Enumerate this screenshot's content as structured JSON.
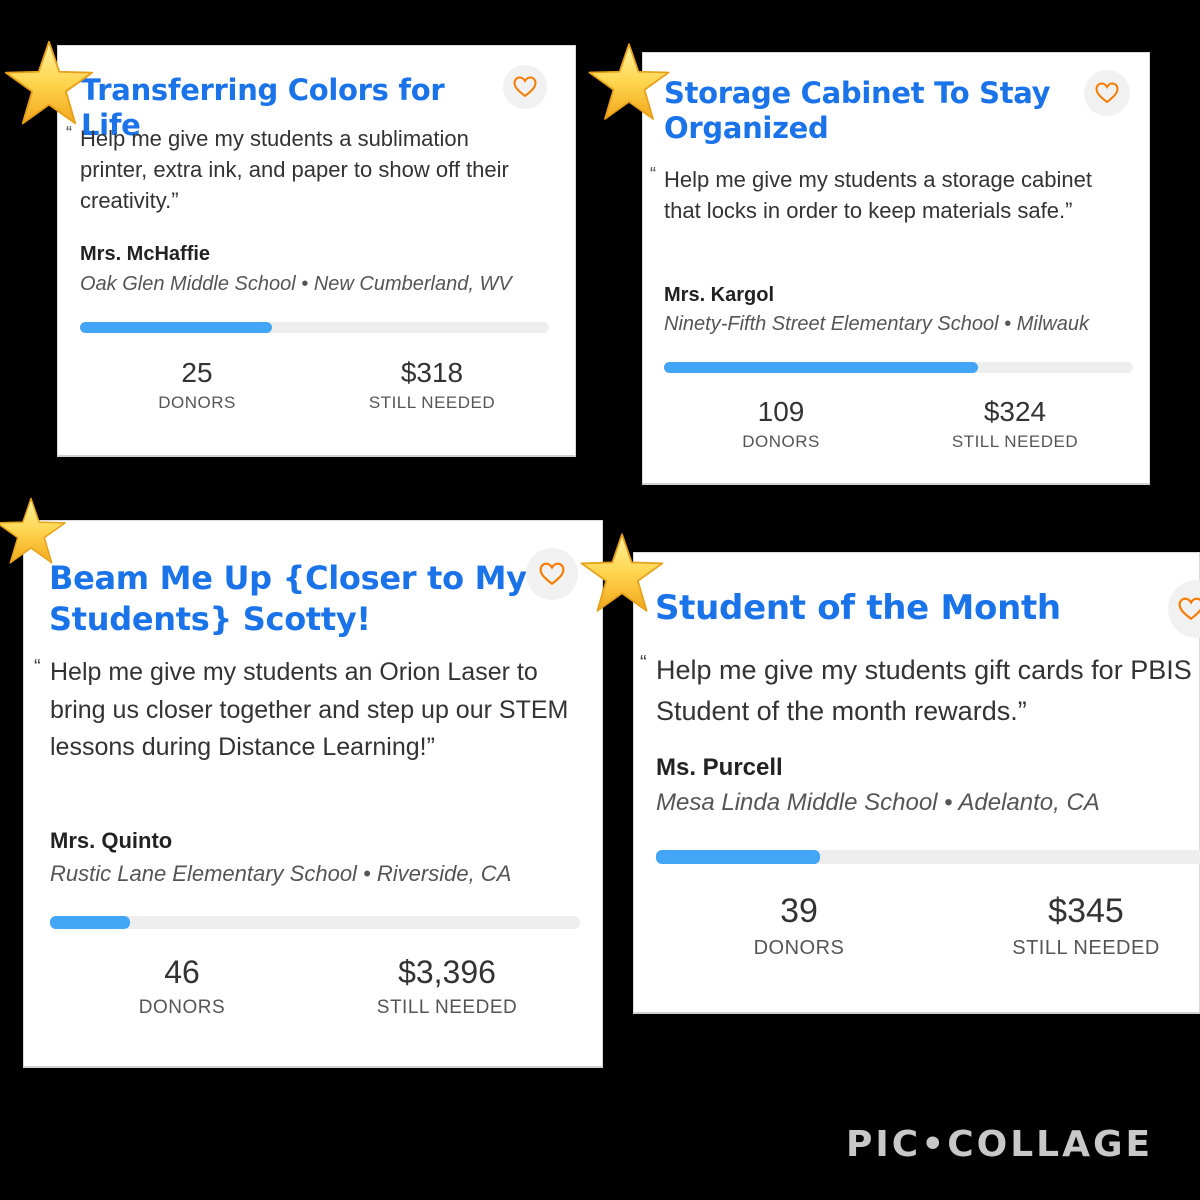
{
  "cards": [
    {
      "title": "Transferring Colors for Life",
      "quote": "Help me give my students a sublimation printer, extra ink, and paper to show off their creativity.",
      "teacher": "Mrs. McHaffie",
      "school": "Oak Glen Middle School",
      "location": "New Cumberland, WV",
      "progress": 0.41,
      "donors": "25",
      "donors_label": "DONORS",
      "needed": "$318",
      "needed_label": "STILL NEEDED"
    },
    {
      "title": "Storage Cabinet To Stay Organized",
      "quote": "Help me give my students a storage cabinet that locks in order to keep materials safe.",
      "teacher": "Mrs. Kargol",
      "school": "Ninety-Fifth Street Elementary School",
      "location": "Milwauk",
      "progress": 0.67,
      "donors": "109",
      "donors_label": "DONORS",
      "needed": "$324",
      "needed_label": "STILL NEEDED"
    },
    {
      "title": "Beam Me Up {Closer to My Students} Scotty!",
      "quote": "Help me give my students an Orion Laser to bring us closer together and step up our STEM lessons during Distance Learning!",
      "teacher": "Mrs. Quinto",
      "school": "Rustic Lane Elementary School",
      "location": "Riverside, CA",
      "progress": 0.15,
      "donors": "46",
      "donors_label": "DONORS",
      "needed": "$3,396",
      "needed_label": "STILL NEEDED"
    },
    {
      "title": "Student of the Month",
      "quote": "Help me give my students gift cards for PBIS Student of the month rewards.",
      "teacher": "Ms. Purcell",
      "school": "Mesa Linda Middle School",
      "location": "Adelanto, CA",
      "progress": 0.29,
      "donors": "39",
      "donors_label": "DONORS",
      "needed": "$345",
      "needed_label": "STILL NEEDED"
    }
  ],
  "separator": "•",
  "quote_open": "“",
  "quote_close": "”",
  "icons": {
    "favorite": "heart-icon",
    "decoration": "star-icon"
  },
  "colors": {
    "title": "#1a73e8",
    "progress": "#42a5f5",
    "heart": "#f57c00",
    "star": "#ffd54f"
  },
  "watermark": "PIC•COLLAGE"
}
